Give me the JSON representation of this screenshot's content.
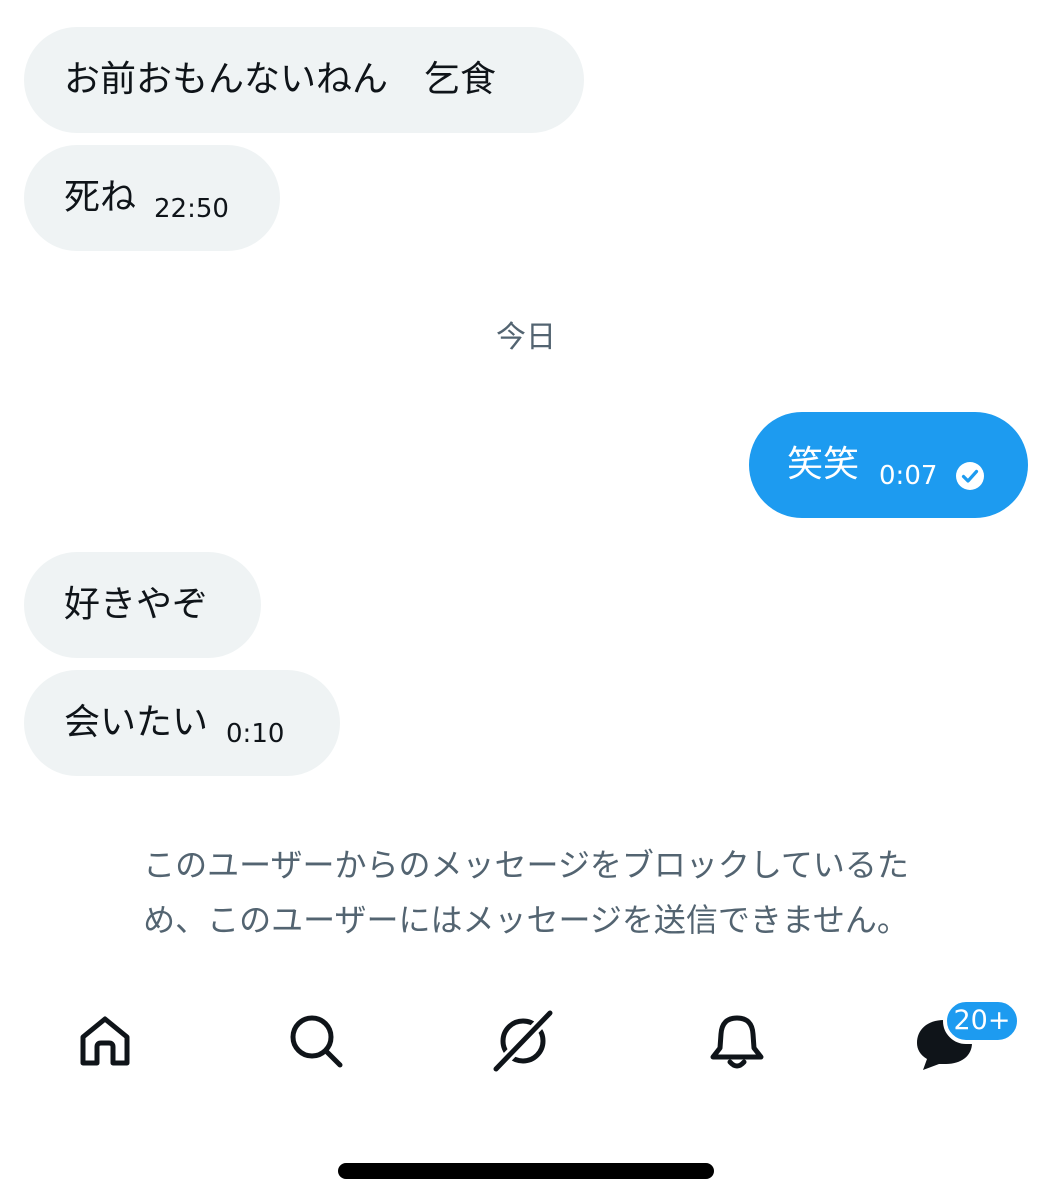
{
  "messages": [
    {
      "text": "お前おもんないねん　乞食",
      "time": ""
    },
    {
      "text": "死ね",
      "time": "22:50"
    },
    {
      "text": "笑笑",
      "time": "0:07"
    },
    {
      "text": "好きやぞ",
      "time": ""
    },
    {
      "text": "会いたい",
      "time": "0:10"
    }
  ],
  "divider_label": "今日",
  "notice_line1": "このユーザーからのメッセージをブロックしているた",
  "notice_line2": "め、このユーザーにはメッセージを送信できません。",
  "nav": {
    "icons": [
      "home-icon",
      "search-icon",
      "spaces-icon",
      "notifications-icon",
      "messages-icon"
    ],
    "messages_badge": "20+"
  },
  "colors": {
    "accent": "#1d9bf0",
    "incoming_bubble": "#eff3f4",
    "secondary_text": "#536471"
  }
}
